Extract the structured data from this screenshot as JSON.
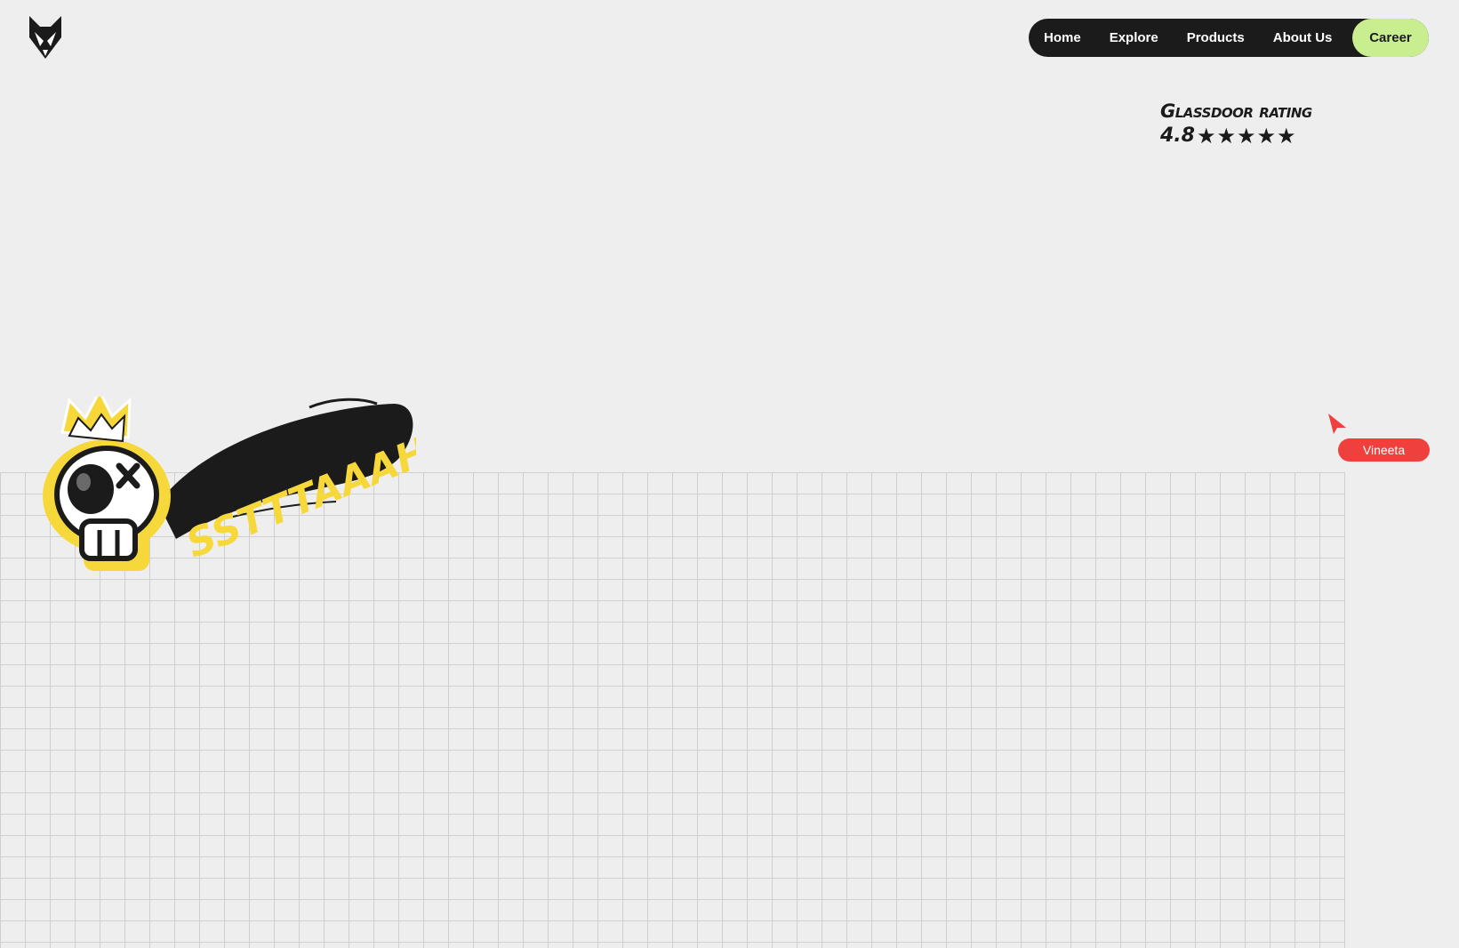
{
  "header": {
    "logo_icon": "fox-head-logo-icon"
  },
  "nav": {
    "items": [
      {
        "label": "Home"
      },
      {
        "label": "Explore"
      },
      {
        "label": "Products"
      },
      {
        "label": "About Us"
      }
    ],
    "cta_label": "Career"
  },
  "rating": {
    "title": "Glassdoor rating",
    "value": "4.8",
    "stars_shown": 5,
    "stars": "★★★★★"
  },
  "collaborator": {
    "name": "Vineeta",
    "cursor_icon": "pointer-cursor-icon",
    "color": "#f0403e"
  },
  "sticker": {
    "text": "SSTTTAAAHW",
    "icon": "crowned-skull-icon"
  },
  "colors": {
    "background": "#eeeeee",
    "nav_background": "#1c1b1b",
    "cta_background": "#c8ee90",
    "sticker_yellow": "#f7d83b",
    "grid_line": "#cfcfcf"
  }
}
